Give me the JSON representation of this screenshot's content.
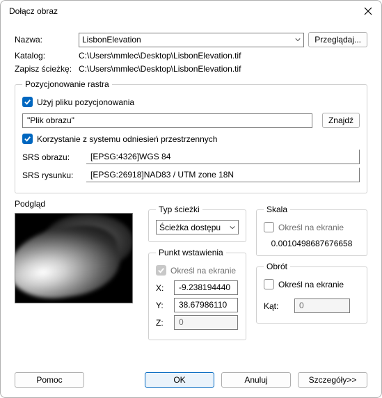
{
  "window": {
    "title": "Dołącz obraz"
  },
  "topform": {
    "name_label": "Nazwa:",
    "name_value": "LisbonElevation",
    "browse_label": "Przeglądaj...",
    "catalog_label": "Katalog:",
    "catalog_value": "C:\\Users\\mmlec\\Desktop\\LisbonElevation.tif",
    "savepath_label": "Zapisz ścieżkę:",
    "savepath_value": "C:\\Users\\mmlec\\Desktop\\LisbonElevation.tif"
  },
  "position_group": {
    "legend": "Pozycjonowanie rastra",
    "use_file_label": "Użyj pliku pozycjonowania",
    "imagefile_value": "\"Plik obrazu\"",
    "find_label": "Znajdź",
    "use_srs_label": "Korzystanie z systemu odniesień przestrzennych",
    "srs_image_label": "SRS obrazu:",
    "srs_image_value": "[EPSG:4326]WGS 84",
    "srs_drawing_label": "SRS rysunku:",
    "srs_drawing_value": "[EPSG:26918]NAD83 / UTM zone 18N"
  },
  "preview": {
    "label": "Podgląd"
  },
  "pathtype": {
    "legend": "Typ ścieżki",
    "value": "Ścieżka dostępu"
  },
  "insertion": {
    "legend": "Punkt wstawienia",
    "specify_label": "Określ na ekranie",
    "x_label": "X:",
    "x_value": "-9.238194440",
    "y_label": "Y:",
    "y_value": "38.67986110",
    "z_label": "Z:",
    "z_value": "0"
  },
  "scale": {
    "legend": "Skala",
    "specify_label": "Określ na ekranie",
    "value": "0.0010498687676658"
  },
  "rotation": {
    "legend": "Obrót",
    "specify_label": "Określ na ekranie",
    "angle_label": "Kąt:",
    "angle_value": "0"
  },
  "footer": {
    "help": "Pomoc",
    "ok": "OK",
    "cancel": "Anuluj",
    "details": "Szczegóły>>"
  }
}
